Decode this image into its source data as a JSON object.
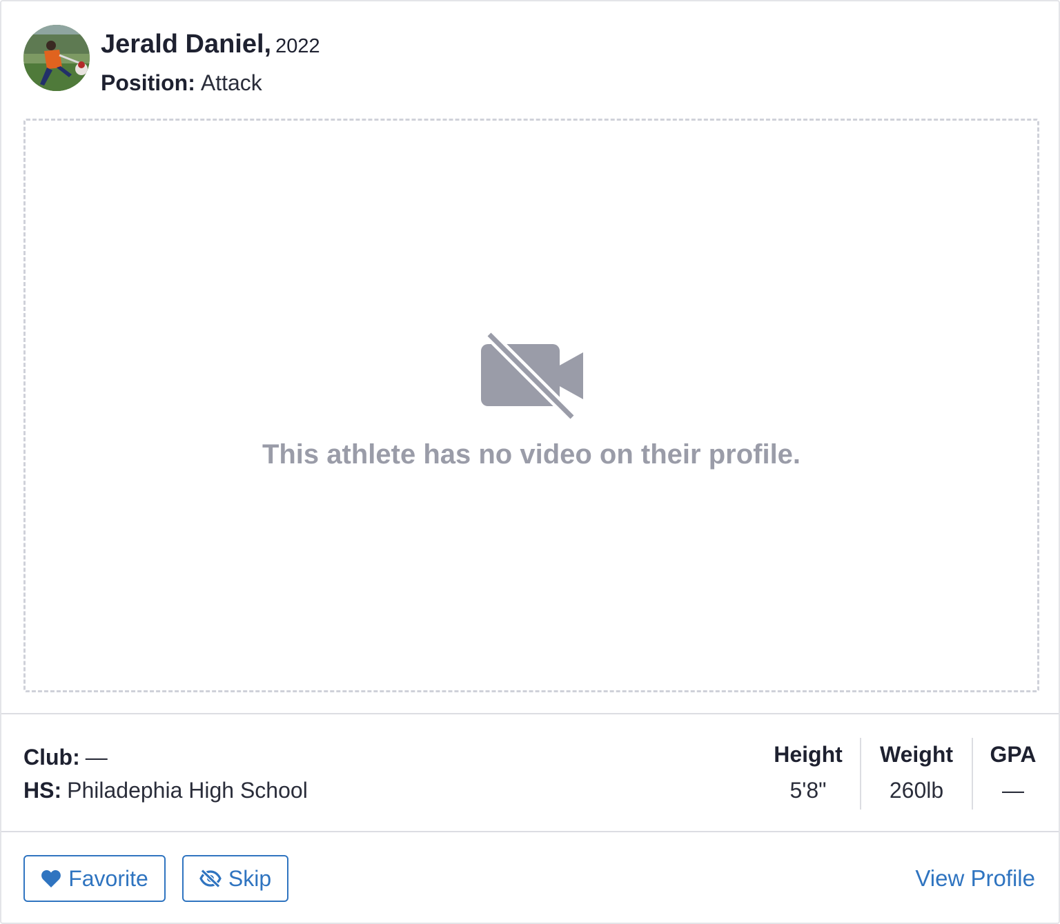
{
  "athlete": {
    "name": "Jerald Daniel,",
    "grad_year": "2022",
    "position_label": "Position:",
    "position": "Attack"
  },
  "video": {
    "icon": "video-slash-icon",
    "empty_message": "This athlete has no video on their profile."
  },
  "info": {
    "club_label": "Club:",
    "club_value": "—",
    "hs_label": "HS:",
    "hs_value": "Philadephia High School"
  },
  "stats": [
    {
      "label": "Height",
      "value": "5'8\""
    },
    {
      "label": "Weight",
      "value": "260lb"
    },
    {
      "label": "GPA",
      "value": "—"
    }
  ],
  "actions": {
    "favorite_label": "Favorite",
    "favorite_icon": "heart-icon",
    "skip_label": "Skip",
    "skip_icon": "eye-slash-icon",
    "view_profile_label": "View Profile"
  },
  "colors": {
    "accent": "#2f74c0",
    "muted_icon": "#9a9ca8",
    "text": "#1e2130"
  }
}
